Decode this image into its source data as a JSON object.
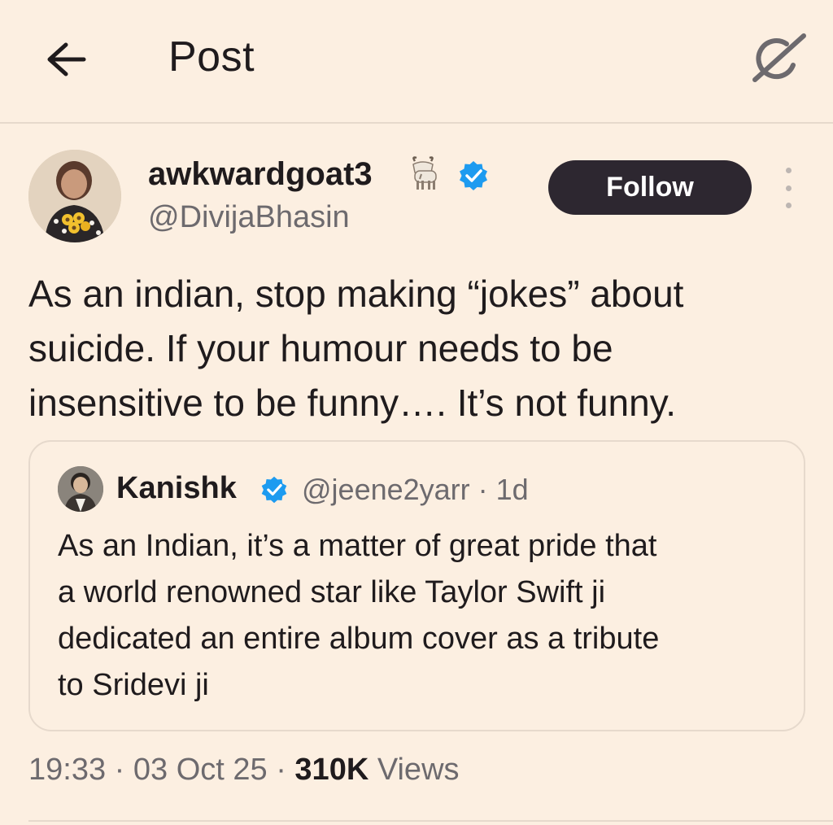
{
  "header": {
    "title": "Post",
    "back_icon": "arrow-left-icon",
    "grok_icon": "grok-icon"
  },
  "post": {
    "author": {
      "name": "awkwardgoat3",
      "emoji_icon": "goat-icon",
      "verified": true,
      "handle": "@DivijaBhasin"
    },
    "follow_label": "Follow",
    "more_icon": "more-vertical-icon",
    "text_lines": [
      "As an indian, stop making “jokes” about",
      "suicide. If your humour needs to be",
      "insensitive to be funny…. It’s not funny."
    ],
    "quoted": {
      "author_name": "Kanishk",
      "verified": true,
      "handle_time": "@jeene2yarr · 1d",
      "text_lines": [
        "As an Indian, it’s a matter of great pride that",
        "a world renowned star like Taylor Swift ji",
        "dedicated an entire album cover as a tribute",
        "to Sridevi ji"
      ]
    },
    "meta": {
      "time": "19:33",
      "separator": "·",
      "date": "03 Oct 25",
      "views_count": "310K",
      "views_label": "Views"
    }
  },
  "colors": {
    "background": "#fcefe1",
    "text": "#1f1b1d",
    "muted": "#6d6a6e",
    "follow_bg": "#2d2730",
    "verified": "#1d9bf0",
    "divider": "#e6d9cc"
  }
}
